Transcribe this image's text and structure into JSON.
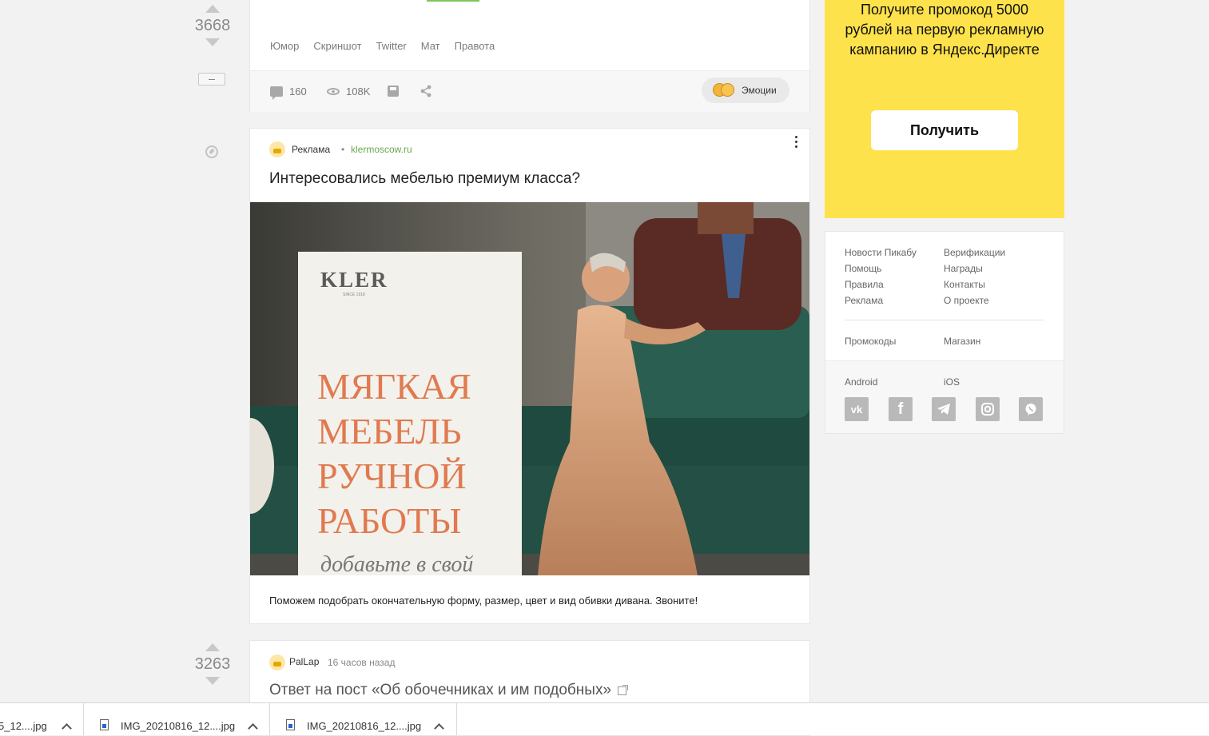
{
  "feed": {
    "post1": {
      "rating": "3668",
      "tags": [
        "Юмор",
        "Скриншот",
        "Twitter",
        "Мат",
        "Правота"
      ],
      "comments": "160",
      "views": "108K",
      "emotions_label": "Эмоции"
    },
    "ad": {
      "label": "Реклама",
      "dot": "•",
      "domain": "klermoscow.ru",
      "title": "Интересовались мебелью премиум класса?",
      "image": {
        "brand": "KLER",
        "brand_sub": "SINCE 1918",
        "headline": [
          "МЯГКАЯ",
          "МЕБЕЛЬ",
          "РУЧНОЙ",
          "РАБОТЫ"
        ],
        "script_line": "добавьте в свой"
      },
      "description": "Поможем подобрать окончательную форму, размер, цвет и вид обивки дивана. Звоните!"
    },
    "post2": {
      "rating": "3263",
      "author": "PalLap",
      "time": "16 часов назад",
      "title": "Ответ на пост «Об обочечниках и им подобных»"
    }
  },
  "sidebar": {
    "promo": {
      "text_lines": [
        "Получите промокод 5000",
        "рублей на первую рекламную",
        "кампанию в Яндекс.Директе"
      ],
      "button": "Получить",
      "color": "#fde24b"
    },
    "links": {
      "col1": [
        "Новости Пикабу",
        "Помощь",
        "Правила",
        "Реклама"
      ],
      "col2": [
        "Верификации",
        "Награды",
        "Контакты",
        "О проекте"
      ],
      "promo_codes": "Промокоды",
      "shop": "Магазин",
      "android": "Android",
      "ios": "iOS"
    },
    "social_icons": [
      "vk-icon",
      "facebook-icon",
      "telegram-icon",
      "instagram-icon",
      "viber-icon"
    ]
  },
  "downloads": [
    {
      "name": "5_12....jpg"
    },
    {
      "name": "IMG_20210816_12....jpg"
    },
    {
      "name": "IMG_20210816_12....jpg"
    }
  ]
}
